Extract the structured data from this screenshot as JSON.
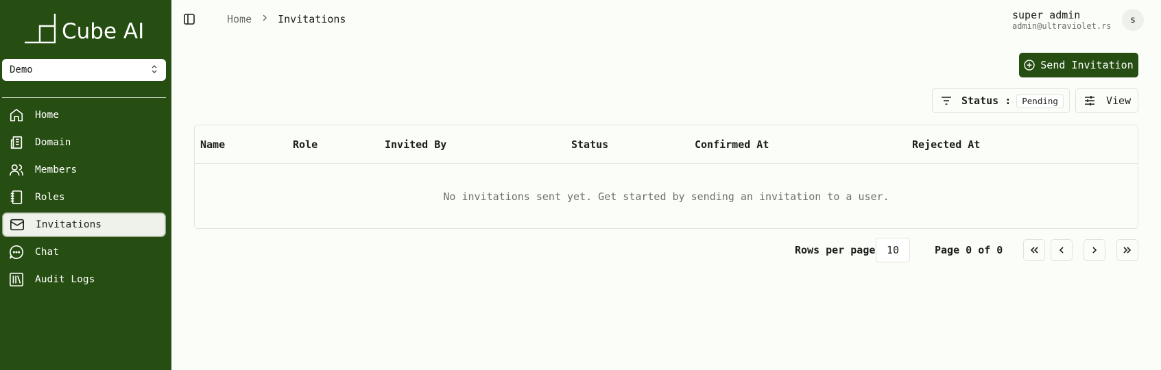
{
  "app": {
    "title": "Cube AI"
  },
  "team_select": {
    "value": "Demo"
  },
  "sidebar": {
    "items": [
      {
        "label": "Home",
        "icon": "home-icon",
        "active": false
      },
      {
        "label": "Domain",
        "icon": "domain-icon",
        "active": false
      },
      {
        "label": "Members",
        "icon": "members-icon",
        "active": false
      },
      {
        "label": "Roles",
        "icon": "roles-icon",
        "active": false
      },
      {
        "label": "Invitations",
        "icon": "mail-icon",
        "active": true
      },
      {
        "label": "Chat",
        "icon": "chat-icon",
        "active": false
      },
      {
        "label": "Audit Logs",
        "icon": "library-icon",
        "active": false
      }
    ]
  },
  "breadcrumb": {
    "home": "Home",
    "current": "Invitations"
  },
  "user": {
    "name": "super admin",
    "email": "admin@ultraviolet.rs",
    "avatar_initial": "s"
  },
  "actions": {
    "send_invitation": "Send Invitation",
    "status_label": "Status :",
    "status_value": "Pending",
    "view_label": "View"
  },
  "table": {
    "columns": [
      "Name",
      "Role",
      "Invited By",
      "Status",
      "Confirmed At",
      "Rejected At"
    ],
    "empty_message": "No invitations sent yet. Get started by sending an invitation to a user."
  },
  "pagination": {
    "rows_per_page_label": "Rows per page",
    "rows_per_page_value": "10",
    "page_info": "Page 0 of 0"
  },
  "colors": {
    "brand": "#264d12",
    "background": "#fbfdf8"
  }
}
